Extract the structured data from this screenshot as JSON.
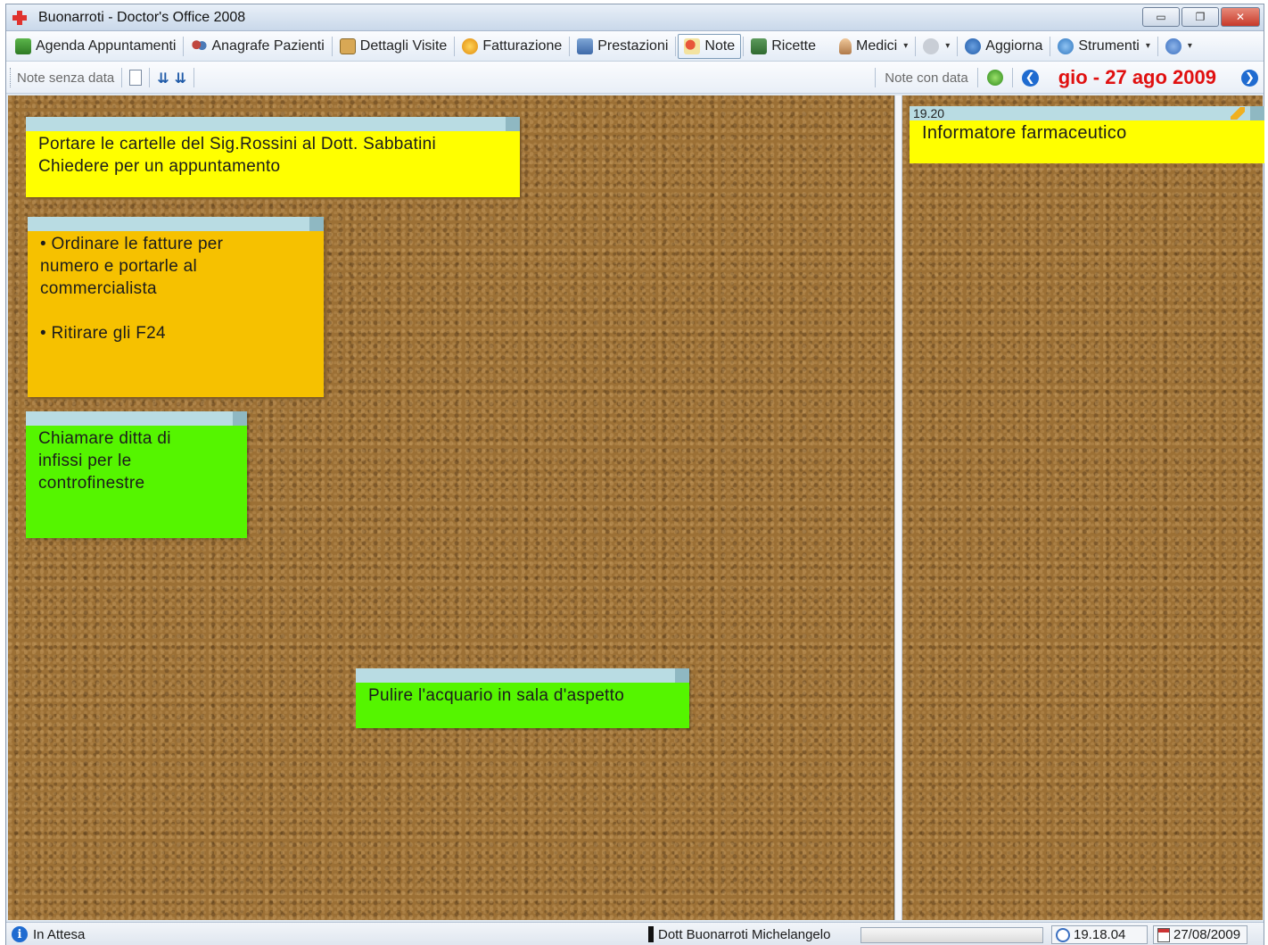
{
  "window": {
    "title": "Buonarroti - Doctor's Office 2008",
    "minimize": "▭",
    "restore": "❐",
    "close": "✕"
  },
  "toolbar": {
    "items": [
      {
        "label": "Agenda Appuntamenti",
        "icon": "agenda-book-icon"
      },
      {
        "label": "Anagrafe Pazienti",
        "icon": "patients-icon"
      },
      {
        "label": "Dettagli Visite",
        "icon": "visit-details-icon"
      },
      {
        "label": "Fatturazione",
        "icon": "billing-coin-icon"
      },
      {
        "label": "Prestazioni",
        "icon": "services-icon"
      },
      {
        "label": "Note",
        "icon": "note-pin-icon",
        "active": true
      },
      {
        "label": "Ricette",
        "icon": "prescriptions-icon"
      },
      {
        "label": "Medici",
        "icon": "doctor-icon"
      },
      {
        "label": "Aggiorna",
        "icon": "refresh-icon"
      },
      {
        "label": "Strumenti",
        "icon": "tools-icon"
      }
    ]
  },
  "subbar": {
    "undated_label": "Note senza data",
    "dated_label": "Note con data",
    "current_date": "gio - 27 ago 2009",
    "prev_arrow": "❮",
    "next_arrow": "❯",
    "sort_icon_1": "⇊",
    "sort_icon_2": "⇊"
  },
  "notes": [
    {
      "color": "#ffff00",
      "lines": [
        "Portare le cartelle del Sig.Rossini al Dott. Sabbatini",
        "Chiedere per un appuntamento"
      ]
    },
    {
      "color": "#f6c100",
      "lines": [
        "• Ordinare le fatture per",
        "numero e portarle al",
        "commercialista",
        "",
        "• Ritirare gli F24"
      ]
    },
    {
      "color": "#55f500",
      "lines": [
        "Chiamare ditta di",
        "infissi per le",
        "controfinestre"
      ]
    },
    {
      "color": "#55f500",
      "lines": [
        "Pulire l'acquario in sala d'aspetto"
      ]
    }
  ],
  "dated_notes": [
    {
      "time": "19.20",
      "text": "Informatore farmaceutico",
      "color": "#ffff00"
    }
  ],
  "statusbar": {
    "status": "In Attesa",
    "user": "Dott Buonarroti Michelangelo",
    "time": "19.18.04",
    "date": "27/08/2009",
    "info_glyph": "i"
  },
  "colors": {
    "date_red": "#e01010",
    "cork": "#9c7035",
    "note_header": "#b9dce3"
  }
}
